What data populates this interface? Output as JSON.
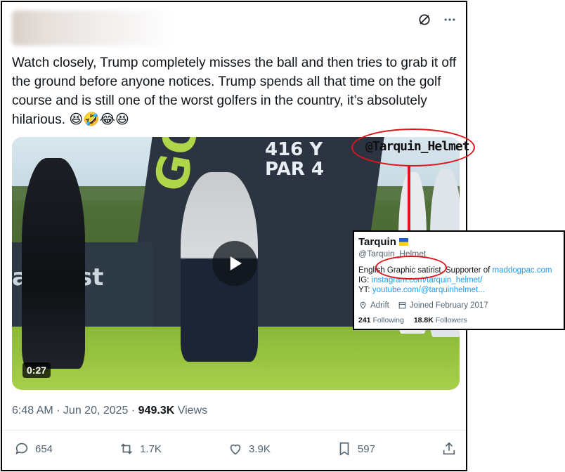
{
  "tweet": {
    "text": "Watch closely, Trump completely misses the ball and then tries to grab it off the ground before anyone notices. Trump spends all that time on the golf course and is still one of the worst golfers in the country, it’s absolutely hilarious. 😆🤣😂😆",
    "timestamp": "6:48 AM · Jun 20, 2025 · ",
    "views_count": "949.3K",
    "views_label": " Views"
  },
  "video": {
    "duration": "0:27",
    "watermark": "@Tarquin_Helmet",
    "sign_line1": "416 Y",
    "sign_line2": "PAR 4",
    "brand_green": "GOLF BUR",
    "brand_left": "aboost"
  },
  "actions": {
    "replies": "654",
    "reposts": "1.7K",
    "likes": "3.9K",
    "bookmarks": "597"
  },
  "profile_card": {
    "name": "Tarquin",
    "handle": "@Tarquin_Helmet",
    "bio_line1_prefix": "English Graphic satirist. Supporter of ",
    "bio_line1_link": "maddogpac.com",
    "bio_line2_prefix": "IG: ",
    "bio_line2_link": "instagram.com/tarquin_helmet/",
    "bio_line3_prefix": "YT: ",
    "bio_line3_link": "youtube.com/@tarquinhelmet...",
    "location": "Adrift",
    "joined": "Joined February 2017",
    "following_count": "241",
    "following_label": " Following",
    "followers_count": "18.8K",
    "followers_label": " Followers"
  },
  "colors": {
    "annotation_red": "#e0141b",
    "link_blue": "#1d9bf0",
    "muted_text": "#536471"
  }
}
